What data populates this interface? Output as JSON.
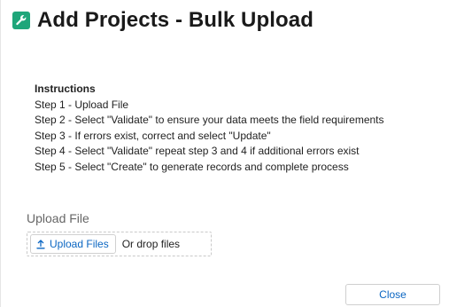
{
  "header": {
    "title": "Add Projects - Bulk Upload",
    "icon": "wrench-icon",
    "icon_color": "#1fa67a"
  },
  "instructions": {
    "heading": "Instructions",
    "steps": [
      "Step 1 - Upload File",
      "Step 2 - Select \"Validate\" to ensure your data meets the field requirements",
      "Step 3 - If errors exist, correct and select \"Update\"",
      "Step 4 - Select \"Validate\" repeat step 3 and 4 if additional errors exist",
      "Step 5 - Select \"Create\" to generate records and complete process"
    ]
  },
  "upload": {
    "label": "Upload File",
    "button_label": "Upload Files",
    "button_icon": "upload-icon",
    "drop_text": "Or drop files"
  },
  "footer": {
    "close_label": "Close"
  },
  "colors": {
    "link_blue": "#0b66c2"
  }
}
